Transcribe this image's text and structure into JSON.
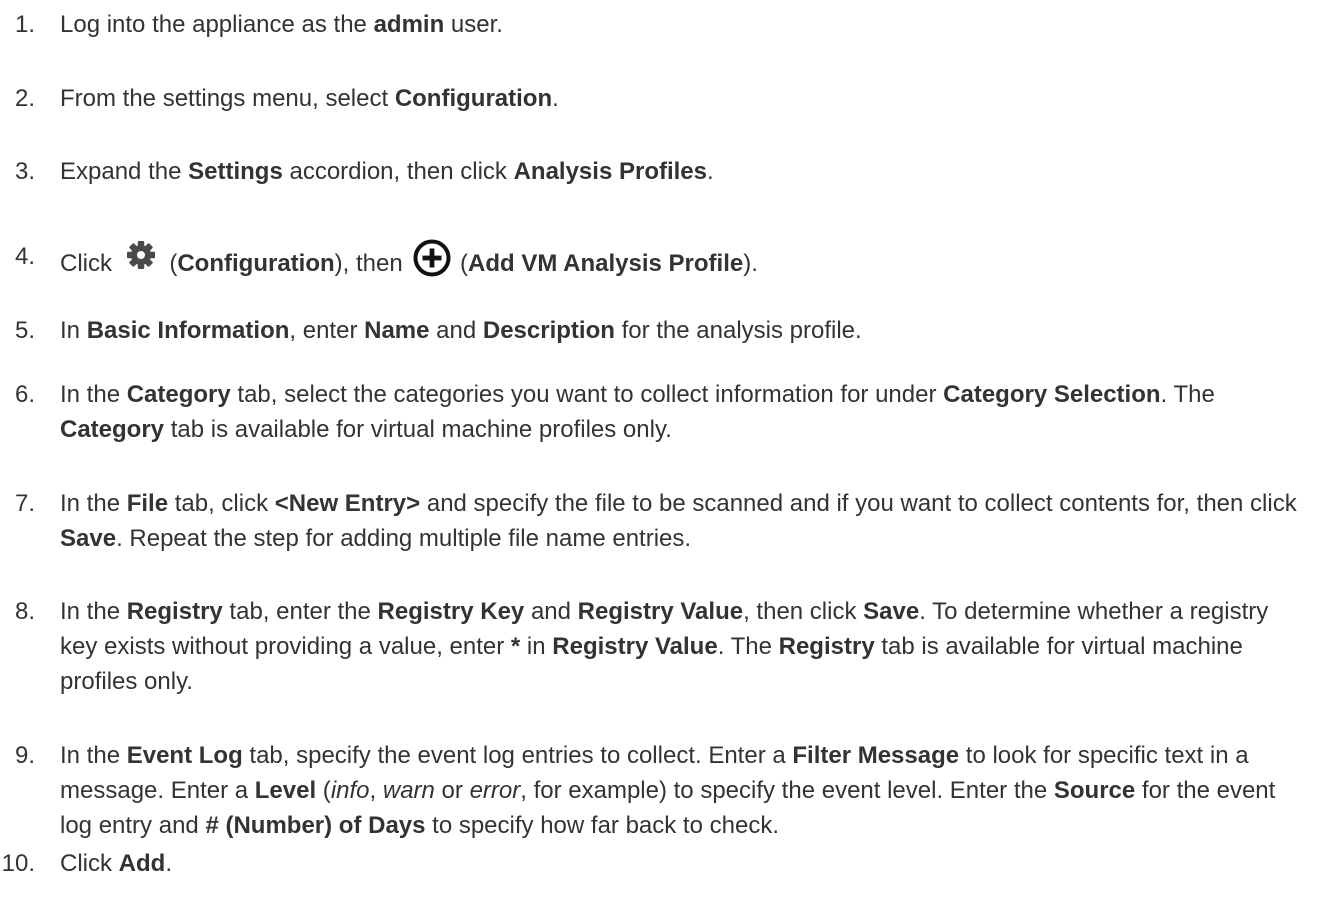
{
  "steps": [
    {
      "num": "1.",
      "parts": [
        {
          "t": "Log into the appliance as the "
        },
        {
          "b": "admin"
        },
        {
          "t": " user."
        }
      ]
    },
    {
      "num": "2.",
      "parts": [
        {
          "t": "From the settings menu, select "
        },
        {
          "b": "Configuration"
        },
        {
          "t": "."
        }
      ]
    },
    {
      "num": "3.",
      "parts": [
        {
          "t": "Expand the "
        },
        {
          "b": "Settings"
        },
        {
          "t": " accordion, then click "
        },
        {
          "b": "Analysis Profiles"
        },
        {
          "t": "."
        }
      ]
    },
    {
      "num": "4.",
      "parts": [
        {
          "t": "Click "
        },
        {
          "icon": "gear-icon"
        },
        {
          "t": " ("
        },
        {
          "b": "Configuration"
        },
        {
          "t": "), then "
        },
        {
          "icon": "plus-circle-icon"
        },
        {
          "t": " ("
        },
        {
          "b": "Add VM Analysis Profile"
        },
        {
          "t": ")."
        }
      ]
    },
    {
      "num": "5.",
      "parts": [
        {
          "t": "In "
        },
        {
          "b": "Basic Information"
        },
        {
          "t": ", enter "
        },
        {
          "b": "Name"
        },
        {
          "t": " and "
        },
        {
          "b": "Description"
        },
        {
          "t": " for the analysis profile."
        }
      ]
    },
    {
      "num": "6.",
      "parts": [
        {
          "t": "In the "
        },
        {
          "b": "Category"
        },
        {
          "t": " tab, select the categories you want to collect information for under "
        },
        {
          "b": "Category Selection"
        },
        {
          "t": ". The "
        },
        {
          "b": "Category"
        },
        {
          "t": " tab is available for virtual machine profiles only."
        }
      ]
    },
    {
      "num": "7.",
      "parts": [
        {
          "t": "In the "
        },
        {
          "b": "File"
        },
        {
          "t": " tab, click "
        },
        {
          "b": "<New Entry>"
        },
        {
          "t": " and specify the file to be scanned and if you want to collect contents for, then click "
        },
        {
          "b": "Save"
        },
        {
          "t": ". Repeat the step for adding multiple file name entries."
        }
      ]
    },
    {
      "num": "8.",
      "parts": [
        {
          "t": "In the "
        },
        {
          "b": "Registry"
        },
        {
          "t": " tab, enter the "
        },
        {
          "b": "Registry Key"
        },
        {
          "t": " and "
        },
        {
          "b": "Registry Value"
        },
        {
          "t": ", then click "
        },
        {
          "b": "Save"
        },
        {
          "t": ". To determine whether a registry key exists without providing a value, enter "
        },
        {
          "b": "*"
        },
        {
          "t": " in "
        },
        {
          "b": "Registry Value"
        },
        {
          "t": ". The "
        },
        {
          "b": "Registry"
        },
        {
          "t": " tab is available for virtual machine profiles only."
        }
      ]
    },
    {
      "num": "9.",
      "parts": [
        {
          "t": "In the "
        },
        {
          "b": "Event Log"
        },
        {
          "t": " tab, specify the event log entries to collect. Enter a "
        },
        {
          "b": "Filter Message"
        },
        {
          "t": " to look for specific text in a message. Enter a "
        },
        {
          "b": "Level"
        },
        {
          "t": " ("
        },
        {
          "i": "info"
        },
        {
          "t": ", "
        },
        {
          "i": "warn"
        },
        {
          "t": " or "
        },
        {
          "i": "error"
        },
        {
          "t": ", for example) to specify the event level. Enter the "
        },
        {
          "b": "Source"
        },
        {
          "t": " for the event log entry and "
        },
        {
          "b": "# (Number) of Days"
        },
        {
          "t": " to specify how far back to check."
        }
      ]
    },
    {
      "num": "10.",
      "parts": [
        {
          "t": "Click "
        },
        {
          "b": "Add"
        },
        {
          "t": "."
        }
      ]
    }
  ]
}
